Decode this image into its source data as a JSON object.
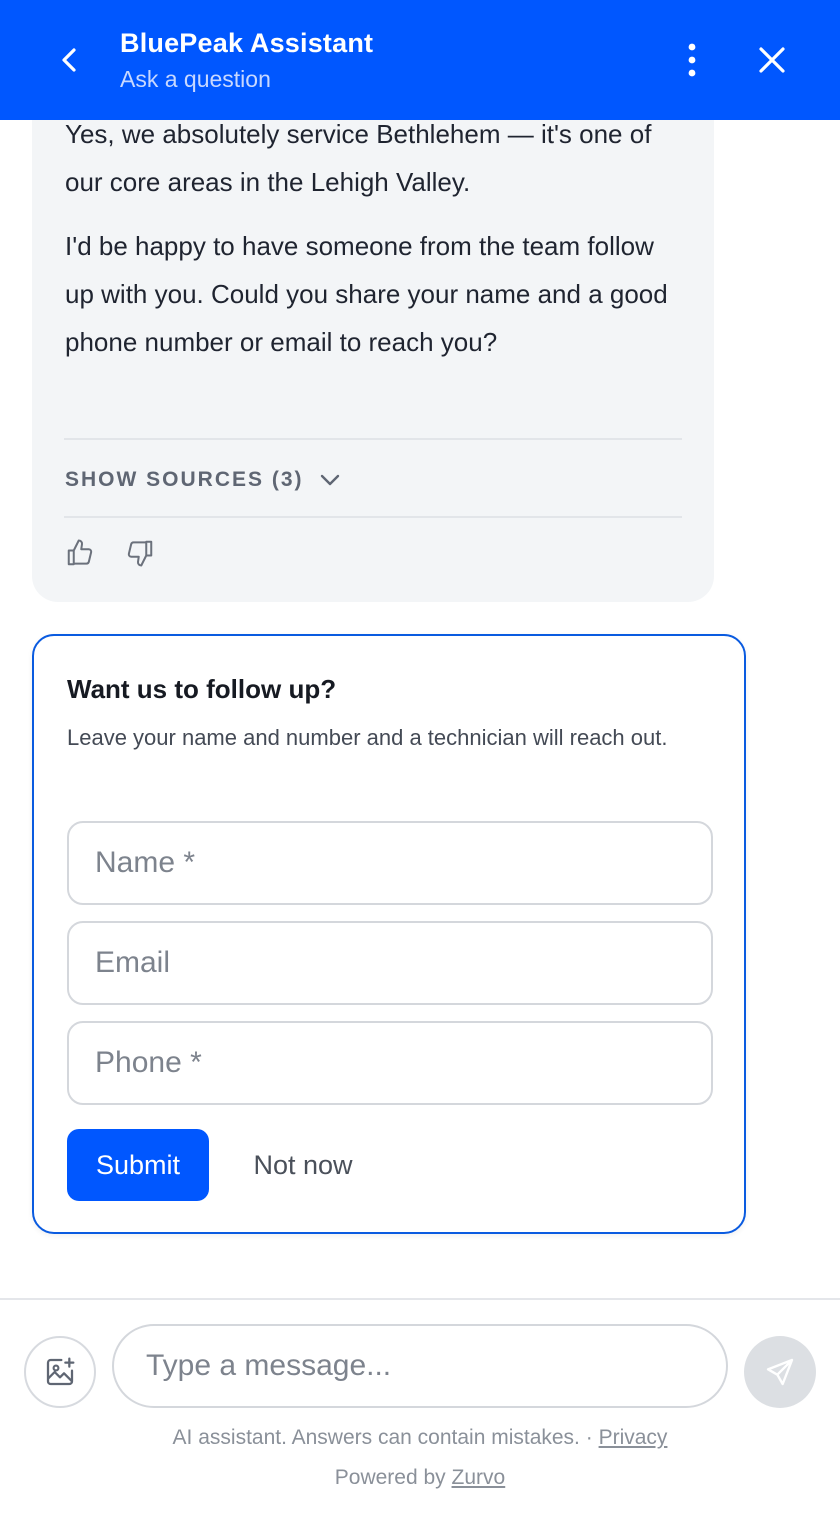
{
  "header": {
    "title": "BluePeak Assistant",
    "subtitle": "Ask a question",
    "background_color": "#0057ff",
    "icons": {
      "back": "chevron-left-icon",
      "menu": "kebab-menu-icon",
      "close": "close-icon"
    }
  },
  "assistant_message": {
    "paragraph_1": "Yes, we absolutely service Bethlehem — it's one of our core areas in the Lehigh Valley.",
    "paragraph_2": "I'd be happy to have someone from the team follow up with you. Could you share your name and a good phone number or email to reach you?",
    "sources_label": "SHOW SOURCES (3)",
    "icons": {
      "sources_toggle": "chevron-down-icon",
      "like": "thumbs-up-icon",
      "dislike": "thumbs-down-icon"
    }
  },
  "followup_form": {
    "title": "Want us to follow up?",
    "description": "Leave your name and number and a technician will reach out.",
    "name_placeholder": "Name *",
    "email_placeholder": "Email",
    "phone_placeholder": "Phone *",
    "submit_label": "Submit",
    "dismiss_label": "Not now",
    "accent_color": "#0a5be0"
  },
  "composer": {
    "placeholder": "Type a message...",
    "icons": {
      "attach": "image-add-icon",
      "send": "send-icon"
    }
  },
  "footer": {
    "disclaimer": "AI assistant. Answers can contain mistakes. ·",
    "privacy_link": "Privacy",
    "powered_by": "Powered by",
    "brand_link": "Zurvo"
  }
}
